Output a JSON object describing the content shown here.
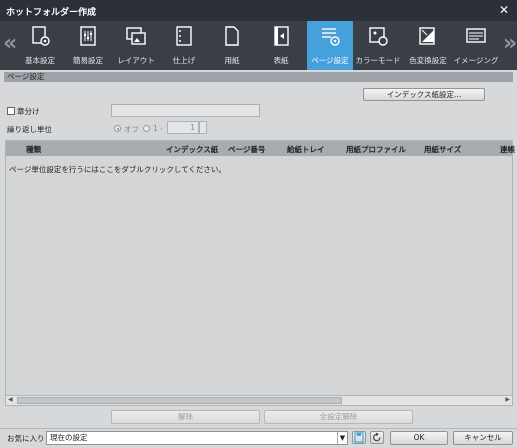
{
  "window": {
    "title": "ホットフォルダー作成"
  },
  "nav": {
    "left_arrow": "«",
    "right_arrow": "»"
  },
  "tabs": [
    {
      "label": "基本設定",
      "icon": "basic-settings-icon"
    },
    {
      "label": "簡易設定",
      "icon": "easy-settings-icon"
    },
    {
      "label": "レイアウト",
      "icon": "layout-icon"
    },
    {
      "label": "仕上げ",
      "icon": "finishing-icon"
    },
    {
      "label": "用紙",
      "icon": "paper-icon"
    },
    {
      "label": "表紙",
      "icon": "cover-icon"
    },
    {
      "label": "ページ設定",
      "icon": "page-settings-icon",
      "active": true
    },
    {
      "label": "カラーモード",
      "icon": "color-mode-icon"
    },
    {
      "label": "色変換設定",
      "icon": "color-conversion-icon"
    },
    {
      "label": "イメージング",
      "icon": "imaging-icon"
    }
  ],
  "section": {
    "title": "ページ設定",
    "index_button": "インデックス紙設定...",
    "chapter_label": "章分け",
    "chapter_value": "",
    "repeat_label": "繰り返し単位",
    "radio_off": "オフ",
    "radio_one": "1 -",
    "repeat_value": "1"
  },
  "table": {
    "columns": [
      "種類",
      "インデックス紙",
      "ページ番号",
      "給紙トレイ",
      "用紙プロファイル",
      "用紙サイズ",
      "連帳"
    ],
    "hint": "ページ単位設定を行うにはここをダブルクリックしてください。"
  },
  "actions": {
    "delete": "解除",
    "delete_all": "全設定解除"
  },
  "footer": {
    "favorites_label": "お気に入り",
    "favorites_value": "現在の設定",
    "ok": "OK",
    "cancel": "キャンセル"
  },
  "colors": {
    "accent": "#46a0dc",
    "titlebar": "#2c3139",
    "toolbar": "#3a3f47"
  }
}
